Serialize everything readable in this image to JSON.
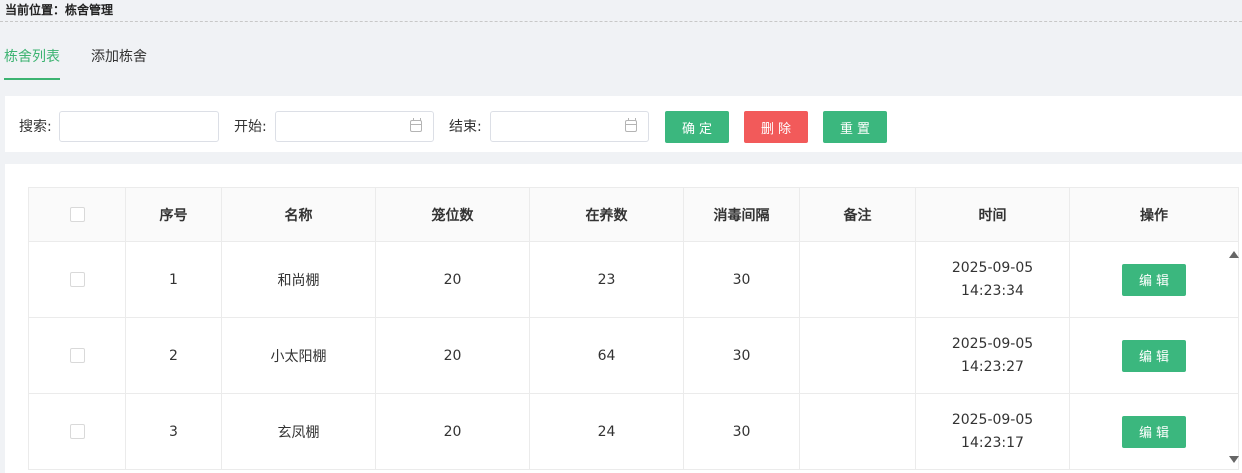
{
  "breadcrumb": {
    "label": "当前位置：",
    "page": "栋舍管理"
  },
  "tabs": [
    {
      "label": "栋舍列表",
      "active": true
    },
    {
      "label": "添加栋舍",
      "active": false
    }
  ],
  "search": {
    "keyword_label": "搜索:",
    "keyword_value": "",
    "start_label": "开始:",
    "start_value": "",
    "end_label": "结束:",
    "end_value": "",
    "confirm_label": "确定",
    "delete_label": "删除",
    "reset_label": "重置"
  },
  "table": {
    "columns": [
      "",
      "序号",
      "名称",
      "笼位数",
      "在养数",
      "消毒间隔",
      "备注",
      "时间",
      "操作"
    ],
    "rows": [
      {
        "index": "1",
        "name": "和尚棚",
        "cages": "20",
        "stock": "23",
        "interval": "30",
        "note": "",
        "date": "2025-09-05",
        "time": "14:23:34",
        "action": "编辑"
      },
      {
        "index": "2",
        "name": "小太阳棚",
        "cages": "20",
        "stock": "64",
        "interval": "30",
        "note": "",
        "date": "2025-09-05",
        "time": "14:23:27",
        "action": "编辑"
      },
      {
        "index": "3",
        "name": "玄凤棚",
        "cages": "20",
        "stock": "24",
        "interval": "30",
        "note": "",
        "date": "2025-09-05",
        "time": "14:23:17",
        "action": "编辑"
      }
    ]
  },
  "colors": {
    "primary": "#3bb77e",
    "danger": "#f25a5a",
    "tab_active": "#3cb371"
  },
  "icons": {
    "date_picker": "calendar-icon",
    "scroll_up": "scroll-up-arrow-icon",
    "scroll_down": "scroll-down-arrow-icon"
  }
}
